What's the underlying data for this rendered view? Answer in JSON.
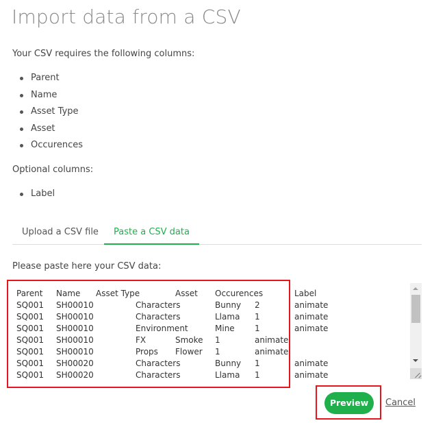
{
  "title": "Import data from a CSV",
  "required": {
    "intro": "Your CSV requires the following columns:",
    "columns": [
      "Parent",
      "Name",
      "Asset Type",
      "Asset",
      "Occurences"
    ]
  },
  "optional": {
    "intro": "Optional columns:",
    "columns": [
      "Label"
    ]
  },
  "tabs": [
    {
      "label": "Upload a CSV file",
      "active": false
    },
    {
      "label": "Paste a CSV data",
      "active": true
    }
  ],
  "paste": {
    "label": "Please paste here your CSV data:",
    "rows": [
      [
        "Parent",
        "Name",
        "Asset Type",
        "Asset",
        "Occurences",
        "Label"
      ],
      [
        "SQ001",
        "SH00010",
        "Characters",
        "Bunny",
        "2",
        "animate"
      ],
      [
        "SQ001",
        "SH00010",
        "Characters",
        "Llama",
        "1",
        "animate"
      ],
      [
        "SQ001",
        "SH00010",
        "Environment",
        "Mine",
        "1",
        "animate"
      ],
      [
        "SQ001",
        "SH00010",
        "FX",
        "Smoke",
        "1",
        "animate"
      ],
      [
        "SQ001",
        "SH00010",
        "Props",
        "Flower",
        "1",
        "animate"
      ],
      [
        "SQ001",
        "SH00020",
        "Characters",
        "Bunny",
        "1",
        "animate"
      ],
      [
        "SQ001",
        "SH00020",
        "Characters",
        "Llama",
        "1",
        "animate"
      ]
    ]
  },
  "actions": {
    "preview_label": "Preview",
    "cancel_label": "Cancel"
  },
  "colors": {
    "accent": "#1faf4b",
    "highlight": "#e8141b"
  }
}
